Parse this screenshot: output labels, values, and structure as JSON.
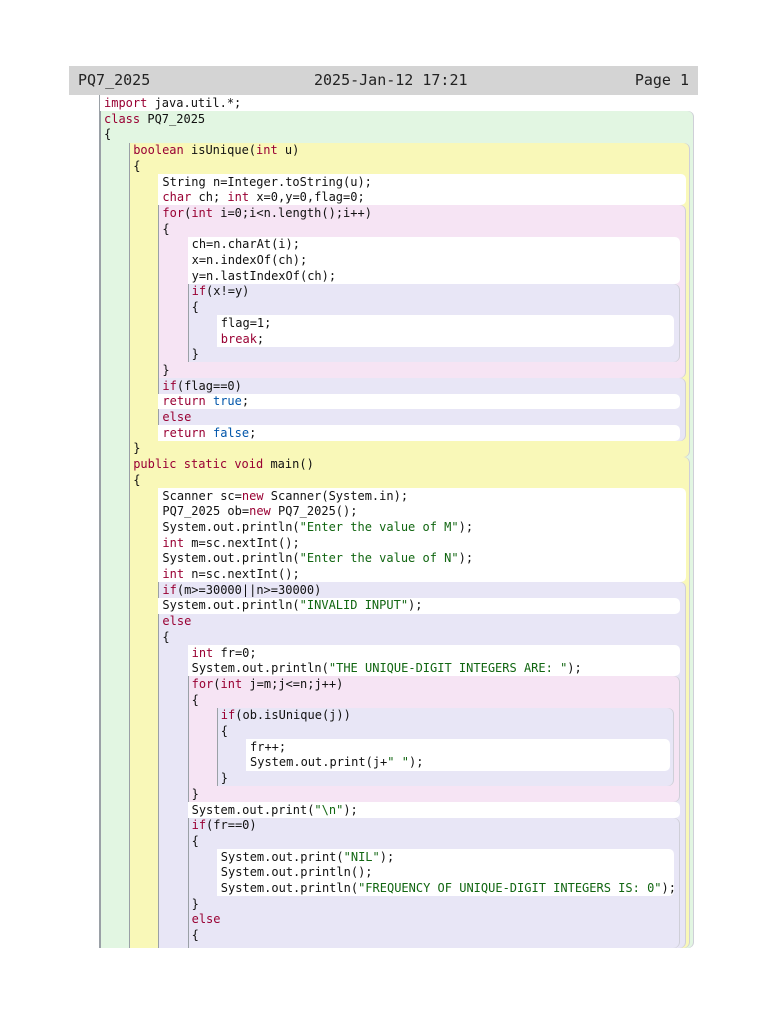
{
  "header": {
    "title": "PQ7_2025",
    "date": "2025-Jan-12 17:21",
    "page": "Page 1"
  },
  "colors": {
    "class_block": "#e2f6e2",
    "method_block": "#f9f8b8",
    "loop_block": "#f6e4f4",
    "if_block": "#e8e6f6",
    "statements": "#ffffff",
    "keyword": "#990033",
    "string": "#116611",
    "literal": "#0055aa"
  },
  "code_lines": [
    {
      "indent": 0,
      "tokens": [
        {
          "t": "import",
          "k": "kw"
        },
        {
          "t": " java.util.*;",
          "k": "pl"
        }
      ]
    },
    {
      "indent": 0,
      "tokens": [
        {
          "t": "class",
          "k": "kw"
        },
        {
          "t": " PQ7_2025",
          "k": "pl"
        }
      ]
    },
    {
      "indent": 0,
      "tokens": [
        {
          "t": "{",
          "k": "pl"
        }
      ]
    },
    {
      "indent": 1,
      "tokens": [
        {
          "t": "boolean",
          "k": "kw"
        },
        {
          "t": " isUnique(",
          "k": "pl"
        },
        {
          "t": "int",
          "k": "kw"
        },
        {
          "t": " u)",
          "k": "pl"
        }
      ]
    },
    {
      "indent": 1,
      "tokens": [
        {
          "t": "{",
          "k": "pl"
        }
      ]
    },
    {
      "indent": 2,
      "tokens": [
        {
          "t": "String n=Integer.toString(u);",
          "k": "pl"
        }
      ]
    },
    {
      "indent": 2,
      "tokens": [
        {
          "t": "char",
          "k": "kw"
        },
        {
          "t": " ch; ",
          "k": "pl"
        },
        {
          "t": "int",
          "k": "kw"
        },
        {
          "t": " x=0,y=0,flag=0;",
          "k": "pl"
        }
      ]
    },
    {
      "indent": 2,
      "tokens": [
        {
          "t": "for",
          "k": "kw"
        },
        {
          "t": "(",
          "k": "pl"
        },
        {
          "t": "int",
          "k": "kw"
        },
        {
          "t": " i=0;i<n.length();i++)",
          "k": "pl"
        }
      ]
    },
    {
      "indent": 2,
      "tokens": [
        {
          "t": "{",
          "k": "pl"
        }
      ]
    },
    {
      "indent": 3,
      "tokens": [
        {
          "t": "ch=n.charAt(i);",
          "k": "pl"
        }
      ]
    },
    {
      "indent": 3,
      "tokens": [
        {
          "t": "x=n.indexOf(ch);",
          "k": "pl"
        }
      ]
    },
    {
      "indent": 3,
      "tokens": [
        {
          "t": "y=n.lastIndexOf(ch);",
          "k": "pl"
        }
      ]
    },
    {
      "indent": 3,
      "tokens": [
        {
          "t": "if",
          "k": "kw"
        },
        {
          "t": "(x!=y)",
          "k": "pl"
        }
      ]
    },
    {
      "indent": 3,
      "tokens": [
        {
          "t": "{",
          "k": "pl"
        }
      ]
    },
    {
      "indent": 4,
      "tokens": [
        {
          "t": "flag=1;",
          "k": "pl"
        }
      ]
    },
    {
      "indent": 4,
      "tokens": [
        {
          "t": "break",
          "k": "kw"
        },
        {
          "t": ";",
          "k": "pl"
        }
      ]
    },
    {
      "indent": 3,
      "tokens": [
        {
          "t": "}",
          "k": "pl"
        }
      ]
    },
    {
      "indent": 2,
      "tokens": [
        {
          "t": "}",
          "k": "pl"
        }
      ]
    },
    {
      "indent": 2,
      "tokens": [
        {
          "t": "if",
          "k": "kw"
        },
        {
          "t": "(flag==0)",
          "k": "pl"
        }
      ]
    },
    {
      "indent": 2,
      "tokens": [
        {
          "t": "return",
          "k": "kw"
        },
        {
          "t": " ",
          "k": "pl"
        },
        {
          "t": "true",
          "k": "lit"
        },
        {
          "t": ";",
          "k": "pl"
        }
      ]
    },
    {
      "indent": 2,
      "tokens": [
        {
          "t": "else",
          "k": "kw"
        }
      ]
    },
    {
      "indent": 2,
      "tokens": [
        {
          "t": "return",
          "k": "kw"
        },
        {
          "t": " ",
          "k": "pl"
        },
        {
          "t": "false",
          "k": "lit"
        },
        {
          "t": ";",
          "k": "pl"
        }
      ]
    },
    {
      "indent": 1,
      "tokens": [
        {
          "t": "}",
          "k": "pl"
        }
      ]
    },
    {
      "indent": 1,
      "tokens": [
        {
          "t": "public static void",
          "k": "kw"
        },
        {
          "t": " main()",
          "k": "pl"
        }
      ]
    },
    {
      "indent": 1,
      "tokens": [
        {
          "t": "{",
          "k": "pl"
        }
      ]
    },
    {
      "indent": 2,
      "tokens": [
        {
          "t": "Scanner sc=",
          "k": "pl"
        },
        {
          "t": "new",
          "k": "kw"
        },
        {
          "t": " Scanner(System.in);",
          "k": "pl"
        }
      ]
    },
    {
      "indent": 2,
      "tokens": [
        {
          "t": "PQ7_2025 ob=",
          "k": "pl"
        },
        {
          "t": "new",
          "k": "kw"
        },
        {
          "t": " PQ7_2025();",
          "k": "pl"
        }
      ]
    },
    {
      "indent": 2,
      "tokens": [
        {
          "t": "System.out.println(",
          "k": "pl"
        },
        {
          "t": "\"Enter the value of M\"",
          "k": "str"
        },
        {
          "t": ");",
          "k": "pl"
        }
      ]
    },
    {
      "indent": 2,
      "tokens": [
        {
          "t": "int",
          "k": "kw"
        },
        {
          "t": " m=sc.nextInt();",
          "k": "pl"
        }
      ]
    },
    {
      "indent": 2,
      "tokens": [
        {
          "t": "System.out.println(",
          "k": "pl"
        },
        {
          "t": "\"Enter the value of N\"",
          "k": "str"
        },
        {
          "t": ");",
          "k": "pl"
        }
      ]
    },
    {
      "indent": 2,
      "tokens": [
        {
          "t": "int",
          "k": "kw"
        },
        {
          "t": " n=sc.nextInt();",
          "k": "pl"
        }
      ]
    },
    {
      "indent": 2,
      "tokens": [
        {
          "t": "if",
          "k": "kw"
        },
        {
          "t": "(m>=30000||n>=30000)",
          "k": "pl"
        }
      ]
    },
    {
      "indent": 2,
      "tokens": [
        {
          "t": "System.out.println(",
          "k": "pl"
        },
        {
          "t": "\"INVALID INPUT\"",
          "k": "str"
        },
        {
          "t": ");",
          "k": "pl"
        }
      ]
    },
    {
      "indent": 2,
      "tokens": [
        {
          "t": "else",
          "k": "kw"
        }
      ]
    },
    {
      "indent": 2,
      "tokens": [
        {
          "t": "{",
          "k": "pl"
        }
      ]
    },
    {
      "indent": 3,
      "tokens": [
        {
          "t": "int",
          "k": "kw"
        },
        {
          "t": " fr=0;",
          "k": "pl"
        }
      ]
    },
    {
      "indent": 3,
      "tokens": [
        {
          "t": "System.out.println(",
          "k": "pl"
        },
        {
          "t": "\"THE UNIQUE-DIGIT INTEGERS ARE: \"",
          "k": "str"
        },
        {
          "t": ");",
          "k": "pl"
        }
      ]
    },
    {
      "indent": 3,
      "tokens": [
        {
          "t": "for",
          "k": "kw"
        },
        {
          "t": "(",
          "k": "pl"
        },
        {
          "t": "int",
          "k": "kw"
        },
        {
          "t": " j=m;j<=n;j++)",
          "k": "pl"
        }
      ]
    },
    {
      "indent": 3,
      "tokens": [
        {
          "t": "{",
          "k": "pl"
        }
      ]
    },
    {
      "indent": 4,
      "tokens": [
        {
          "t": "if",
          "k": "kw"
        },
        {
          "t": "(ob.isUnique(j))",
          "k": "pl"
        }
      ]
    },
    {
      "indent": 4,
      "tokens": [
        {
          "t": "{",
          "k": "pl"
        }
      ]
    },
    {
      "indent": 5,
      "tokens": [
        {
          "t": "fr++;",
          "k": "pl"
        }
      ]
    },
    {
      "indent": 5,
      "tokens": [
        {
          "t": "System.out.print(j+",
          "k": "pl"
        },
        {
          "t": "\" \"",
          "k": "str"
        },
        {
          "t": ");",
          "k": "pl"
        }
      ]
    },
    {
      "indent": 4,
      "tokens": [
        {
          "t": "}",
          "k": "pl"
        }
      ]
    },
    {
      "indent": 3,
      "tokens": [
        {
          "t": "}",
          "k": "pl"
        }
      ]
    },
    {
      "indent": 3,
      "tokens": [
        {
          "t": "System.out.print(",
          "k": "pl"
        },
        {
          "t": "\"\\n\"",
          "k": "str"
        },
        {
          "t": ");",
          "k": "pl"
        }
      ]
    },
    {
      "indent": 3,
      "tokens": [
        {
          "t": "if",
          "k": "kw"
        },
        {
          "t": "(fr==0)",
          "k": "pl"
        }
      ]
    },
    {
      "indent": 3,
      "tokens": [
        {
          "t": "{",
          "k": "pl"
        }
      ]
    },
    {
      "indent": 4,
      "tokens": [
        {
          "t": "System.out.print(",
          "k": "pl"
        },
        {
          "t": "\"NIL\"",
          "k": "str"
        },
        {
          "t": ");",
          "k": "pl"
        }
      ]
    },
    {
      "indent": 4,
      "tokens": [
        {
          "t": "System.out.println();",
          "k": "pl"
        }
      ]
    },
    {
      "indent": 4,
      "tokens": [
        {
          "t": "System.out.println(",
          "k": "pl"
        },
        {
          "t": "\"FREQUENCY OF UNIQUE-DIGIT INTEGERS IS: 0\"",
          "k": "str"
        },
        {
          "t": ");",
          "k": "pl"
        }
      ]
    },
    {
      "indent": 3,
      "tokens": [
        {
          "t": "}",
          "k": "pl"
        }
      ]
    },
    {
      "indent": 3,
      "tokens": [
        {
          "t": "else",
          "k": "kw"
        }
      ]
    },
    {
      "indent": 3,
      "tokens": [
        {
          "t": "{",
          "k": "pl"
        }
      ]
    }
  ]
}
